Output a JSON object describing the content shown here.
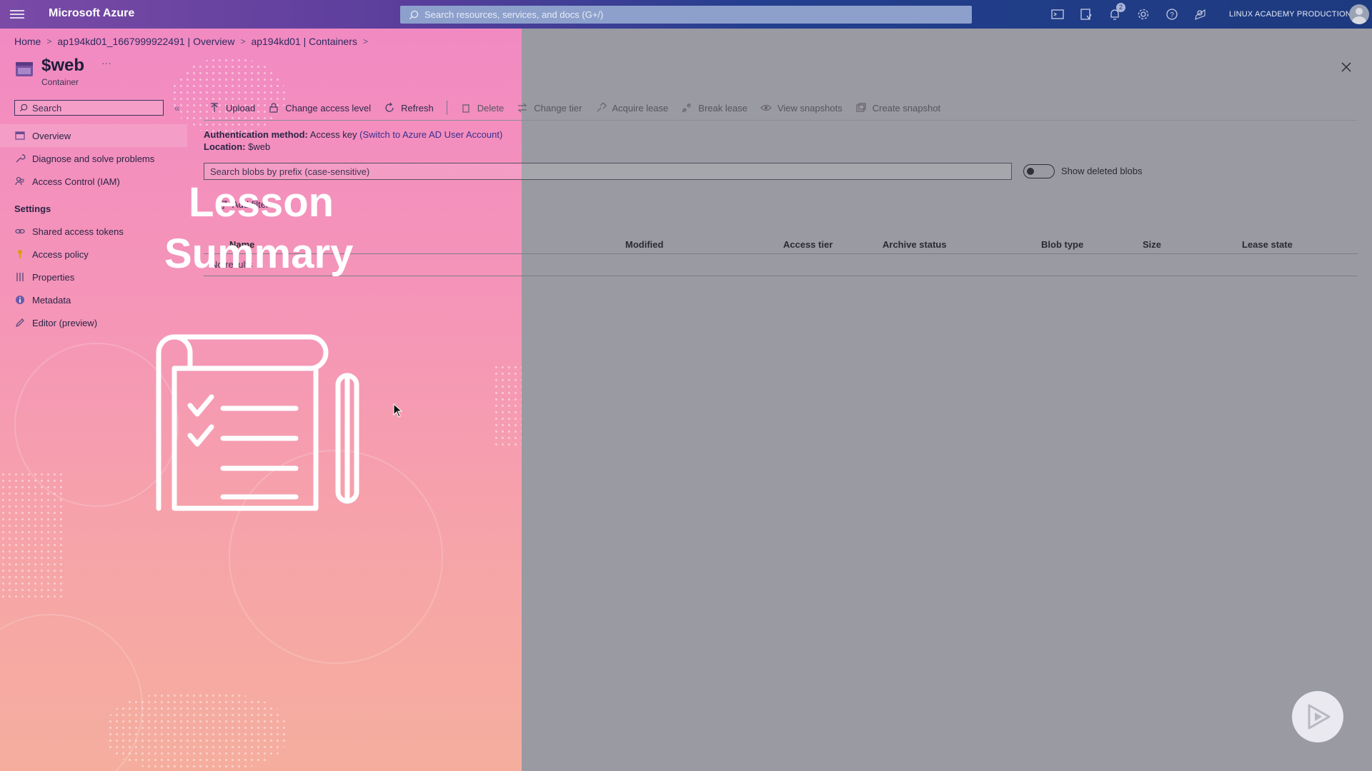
{
  "topbar": {
    "brand": "Microsoft Azure",
    "search_placeholder": "Search resources, services, and docs (G+/)",
    "notification_count": "2",
    "account": "LINUX ACADEMY PRODUCTION ..."
  },
  "breadcrumb": [
    "Home",
    "ap194kd01_1667999922491 | Overview",
    "ap194kd01 | Containers"
  ],
  "resource": {
    "title": "$web",
    "more": "···",
    "subtitle": "Container"
  },
  "sidebar": {
    "search_placeholder": "Search",
    "collapse": "«",
    "items": [
      {
        "label": "Overview",
        "icon": "overview-icon"
      },
      {
        "label": "Diagnose and solve problems",
        "icon": "wrench-icon"
      },
      {
        "label": "Access Control (IAM)",
        "icon": "people-icon"
      }
    ],
    "settings_title": "Settings",
    "settings_items": [
      {
        "label": "Shared access tokens",
        "icon": "link-icon"
      },
      {
        "label": "Access policy",
        "icon": "key-icon"
      },
      {
        "label": "Properties",
        "icon": "properties-icon"
      },
      {
        "label": "Metadata",
        "icon": "info-icon"
      },
      {
        "label": "Editor (preview)",
        "icon": "pencil-icon"
      }
    ]
  },
  "toolbar": {
    "upload": "Upload",
    "change_access": "Change access level",
    "refresh": "Refresh",
    "delete": "Delete",
    "change_tier": "Change tier",
    "acquire_lease": "Acquire lease",
    "break_lease": "Break lease",
    "view_snapshots": "View snapshots",
    "create_snapshot": "Create snapshot"
  },
  "auth": {
    "method_label": "Authentication method:",
    "method_value": "Access key",
    "switch_link": "(Switch to Azure AD User Account)",
    "location_label": "Location:",
    "location_value": "$web"
  },
  "blobs": {
    "search_placeholder": "Search blobs by prefix (case-sensitive)",
    "show_deleted": "Show deleted blobs",
    "add_filter": "Add filter",
    "columns": [
      "Name",
      "Modified",
      "Access tier",
      "Archive status",
      "Blob type",
      "Size",
      "Lease state"
    ],
    "empty": "No results"
  },
  "overlay": {
    "line1": "Lesson",
    "line2": "Summary"
  },
  "colors": {
    "pink_top": "#f28ac2",
    "pink_bottom": "#f5ae9e",
    "gray": "#9a9aa2",
    "topbar": "#1d3a7f"
  }
}
